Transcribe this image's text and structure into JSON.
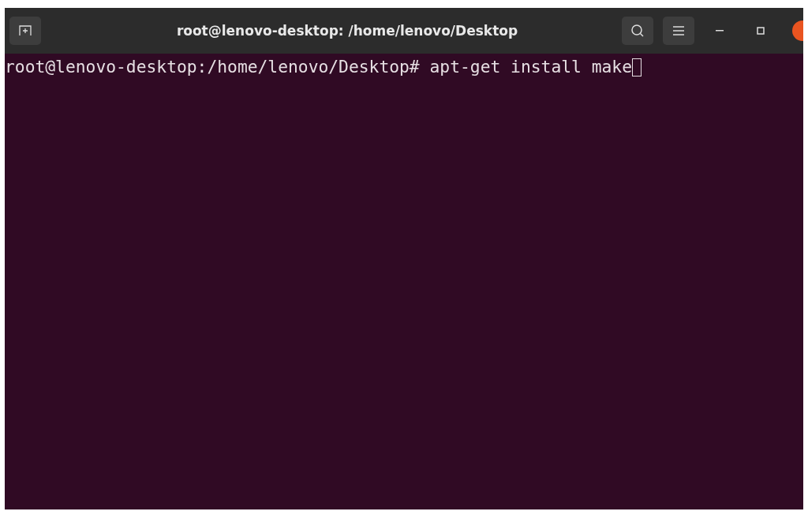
{
  "window": {
    "title": "root@lenovo-desktop: /home/lenovo/Desktop"
  },
  "terminal": {
    "lines": [
      "root@lenovo-desktop:/home/lenovo/Desktop# apt-get install make"
    ]
  }
}
